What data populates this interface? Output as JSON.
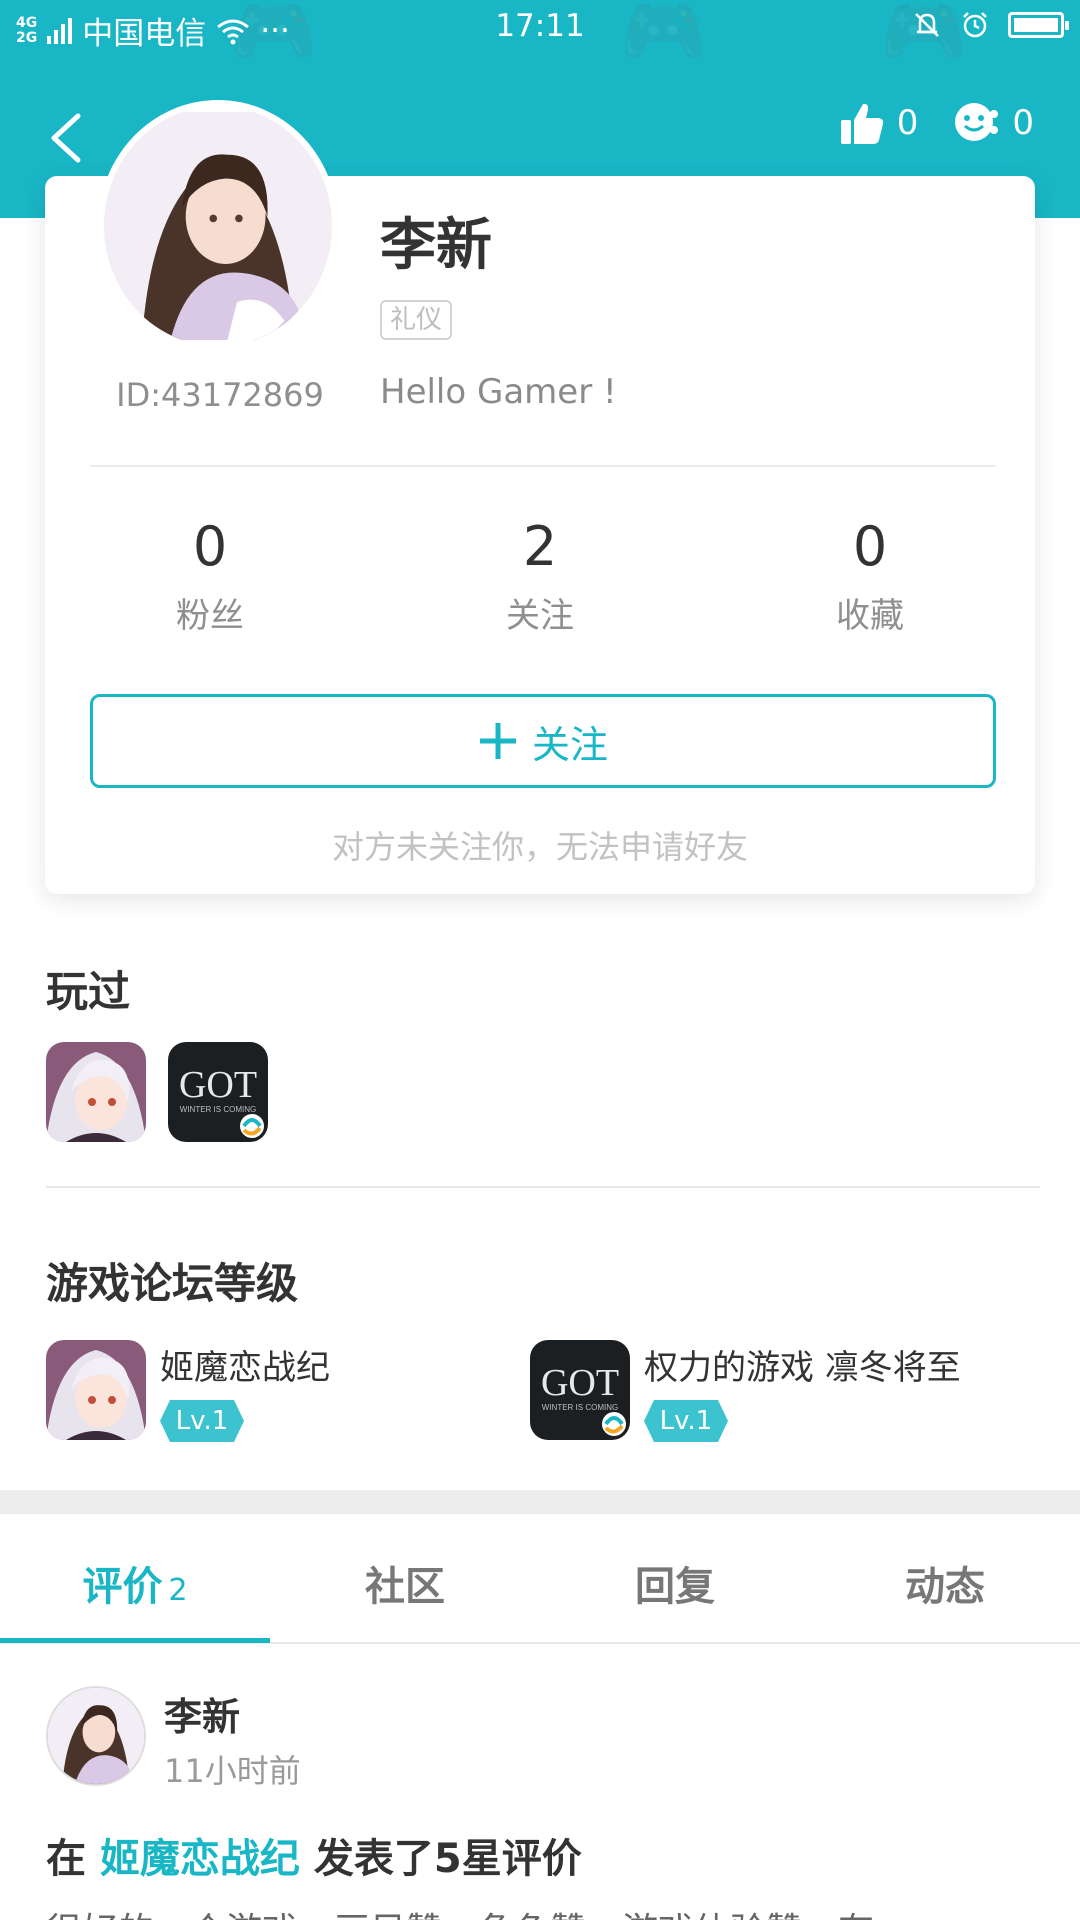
{
  "status_bar": {
    "network": "4G",
    "network2": "2G",
    "carrier": "中国电信",
    "dots": "···",
    "time": "17:11"
  },
  "header": {
    "likes_count": "0",
    "faces_count": "0"
  },
  "profile": {
    "name": "李新",
    "tag": "礼仪",
    "id_text": "ID:43172869",
    "bio": "Hello Gamer !",
    "stats": [
      {
        "value": "0",
        "label": "粉丝"
      },
      {
        "value": "2",
        "label": "关注"
      },
      {
        "value": "0",
        "label": "收藏"
      }
    ],
    "follow_button": "关注",
    "friend_hint": "对方未关注你，无法申请好友"
  },
  "played": {
    "title": "玩过",
    "games": [
      {
        "icon": "anime-girl-game-icon"
      },
      {
        "icon": "got-game-icon",
        "text": "GOT",
        "subtext": "WINTER IS COMING"
      }
    ]
  },
  "forum_levels": {
    "title": "游戏论坛等级",
    "items": [
      {
        "name": "姬魔恋战纪",
        "level": "Lv.1"
      },
      {
        "name": "权力的游戏 凛冬将至",
        "level": "Lv.1"
      }
    ]
  },
  "tabs": [
    {
      "label": "评价",
      "count": "2"
    },
    {
      "label": "社区"
    },
    {
      "label": "回复"
    },
    {
      "label": "动态"
    }
  ],
  "post": {
    "author": "李新",
    "time": "11小时前",
    "prefix": "在",
    "game_link": "姬魔恋战纪",
    "suffix": "发表了5星评价",
    "snippet": "很好的一个游戏，画风赞，角色赞，游戏体验赞，有"
  },
  "colors": {
    "accent": "#19b6c6",
    "text": "#333333",
    "muted": "#8f8f8f"
  }
}
